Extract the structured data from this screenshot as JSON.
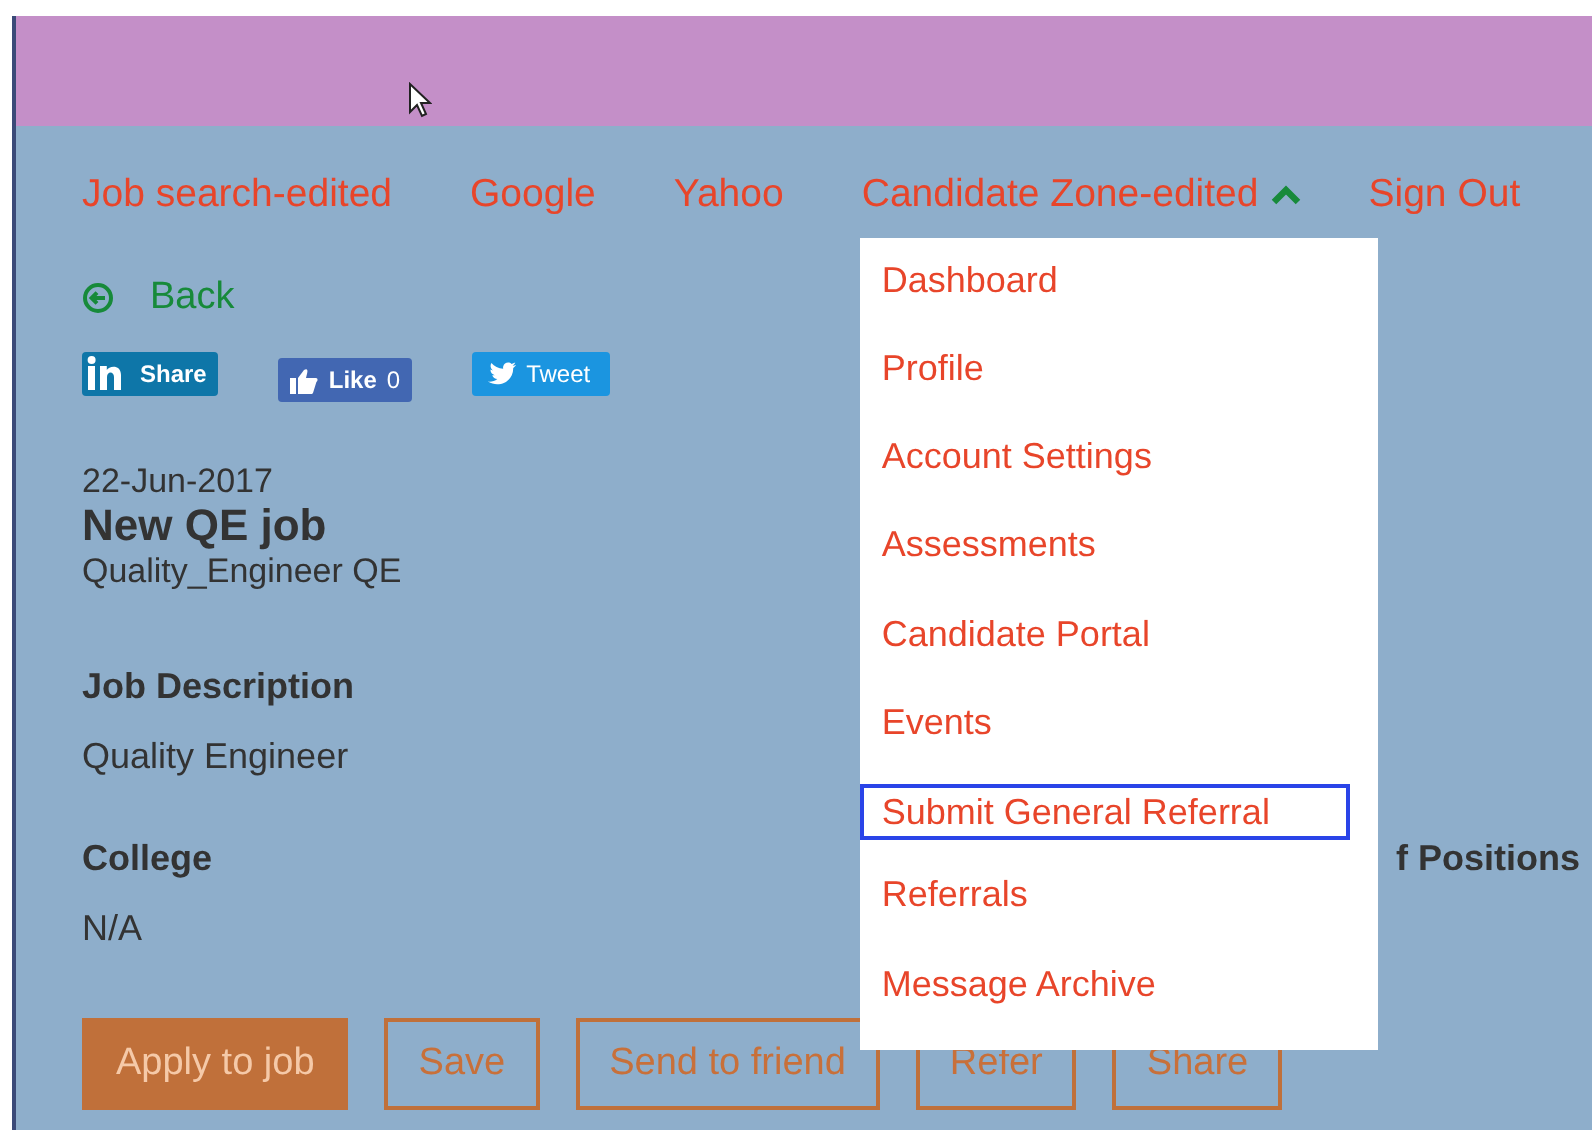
{
  "nav": {
    "items": [
      {
        "kind": "link",
        "label": "Job search-edited"
      },
      {
        "kind": "link",
        "label": "Google"
      },
      {
        "kind": "link",
        "label": "Yahoo"
      },
      {
        "kind": "menu",
        "label": "Candidate Zone-edited",
        "expanded": true,
        "menu_items": [
          {
            "label": "Dashboard",
            "focused": false
          },
          {
            "label": "Profile",
            "focused": false
          },
          {
            "label": "Account Settings",
            "focused": false
          },
          {
            "label": "Assessments",
            "focused": false
          },
          {
            "label": "Candidate Portal",
            "focused": false
          },
          {
            "label": "Events",
            "focused": false
          },
          {
            "label": "Submit General Referral",
            "focused": true
          },
          {
            "label": "Referrals",
            "focused": false
          },
          {
            "label": "Message Archive",
            "focused": false
          }
        ]
      },
      {
        "kind": "link",
        "label": "Sign Out"
      }
    ]
  },
  "back": {
    "label": "Back"
  },
  "social": [
    {
      "kind": "linkedin",
      "label": "Share"
    },
    {
      "kind": "facebook",
      "label": "Like",
      "count": "0"
    },
    {
      "kind": "twitter",
      "label": "Tweet"
    }
  ],
  "job": {
    "date": "22-Jun-2017",
    "title": "New QE job",
    "subtitle": "Quality_Engineer QE",
    "sections": [
      {
        "heading": "Job Description",
        "value": "Quality Engineer"
      },
      {
        "heading": "College",
        "value": "N/A",
        "side_heading": "f Positions"
      }
    ]
  },
  "actions": [
    {
      "label": "Apply to job",
      "kind": "primary"
    },
    {
      "label": "Save",
      "kind": "outline"
    },
    {
      "label": "Send to friend",
      "kind": "outline"
    },
    {
      "label": "Refer",
      "kind": "outline"
    },
    {
      "label": "Share",
      "kind": "outline"
    }
  ]
}
